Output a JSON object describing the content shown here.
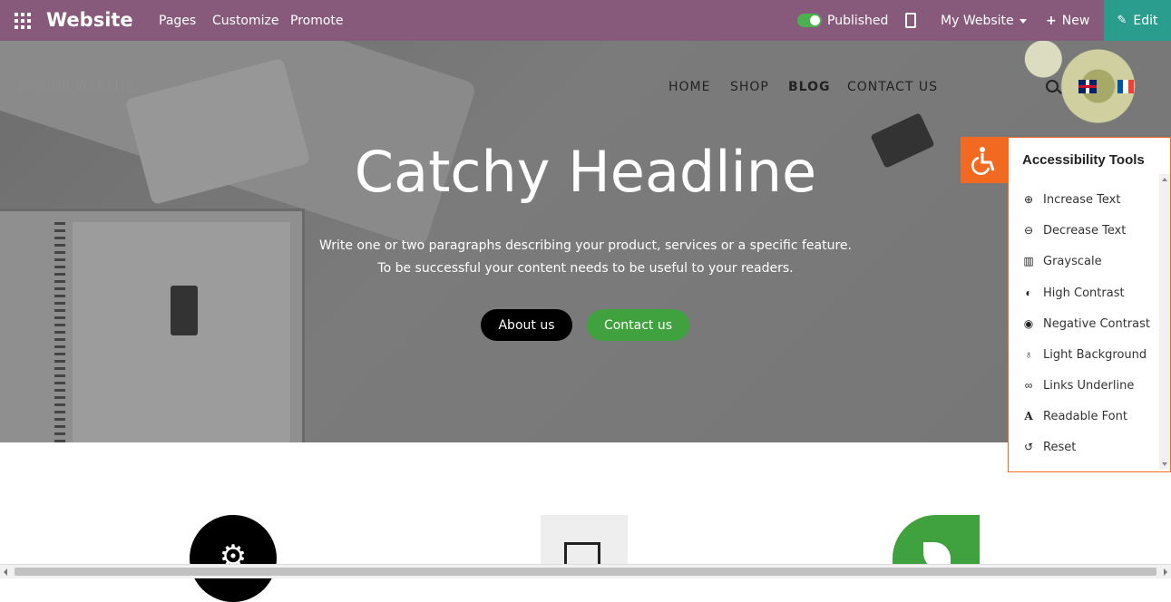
{
  "topbar": {
    "brand": "Website",
    "menu": [
      "Pages",
      "Customize",
      "Promote"
    ],
    "published_label": "Published",
    "published_on": true,
    "site_selector": "My Website",
    "new_label": "New",
    "edit_label": "Edit",
    "colors": {
      "bar": "#875a7b",
      "edit": "#2a9d8f"
    }
  },
  "site": {
    "logo_text": "YOUR WEBSITE",
    "nav": [
      "HOME",
      "SHOP",
      "BLOG",
      "CONTACT US"
    ],
    "active_nav": "BLOG",
    "languages": [
      "English (UK)",
      "Français"
    ]
  },
  "hero": {
    "headline": "Catchy Headline",
    "paragraph_line1": "Write one or two paragraphs describing your product, services or a specific feature.",
    "paragraph_line2": "To be successful your content needs to be useful to your readers.",
    "primary_button": "About us",
    "secondary_button": "Contact us",
    "colors": {
      "secondary": "#3fa23f"
    }
  },
  "accessibility": {
    "title": "Accessibility Tools",
    "accent": "#f26a21",
    "items": [
      {
        "icon": "zoom-in-icon",
        "label": "Increase Text"
      },
      {
        "icon": "zoom-out-icon",
        "label": "Decrease Text"
      },
      {
        "icon": "barcode-icon",
        "label": "Grayscale"
      },
      {
        "icon": "contrast-icon",
        "label": "High Contrast"
      },
      {
        "icon": "eye-icon",
        "label": "Negative Contrast"
      },
      {
        "icon": "lightbulb-icon",
        "label": "Light Background"
      },
      {
        "icon": "link-icon",
        "label": "Links Underline"
      },
      {
        "icon": "font-icon",
        "label": "Readable Font"
      },
      {
        "icon": "reset-icon",
        "label": "Reset"
      }
    ]
  }
}
